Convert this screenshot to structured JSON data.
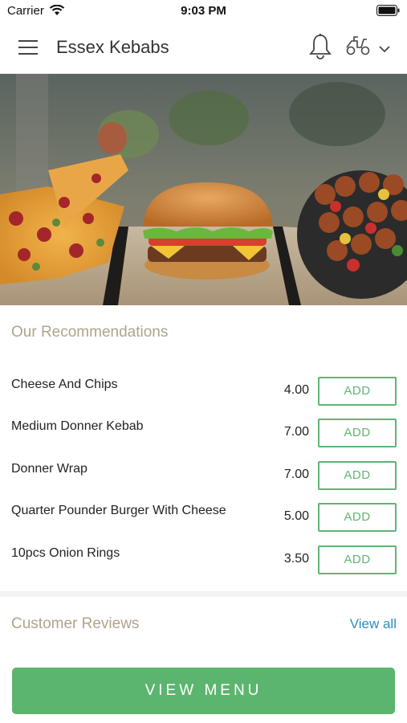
{
  "status_bar": {
    "carrier": "Carrier",
    "time": "9:03 PM"
  },
  "header": {
    "title": "Essex Kebabs",
    "icons": [
      "menu-icon",
      "bell-icon",
      "scooter-icon",
      "chevron-down-icon"
    ]
  },
  "hero": {
    "description": "pizza-burger-kebab-skewers"
  },
  "recommendations": {
    "title": "Our Recommendations",
    "items": [
      {
        "name": "Cheese And Chips",
        "price": "4.00",
        "button": "ADD"
      },
      {
        "name": "Medium Donner Kebab",
        "price": "7.00",
        "button": "ADD"
      },
      {
        "name": "Donner Wrap",
        "price": "7.00",
        "button": "ADD"
      },
      {
        "name": "Quarter Pounder Burger With Cheese",
        "price": "5.00",
        "button": "ADD"
      },
      {
        "name": "10pcs Onion Rings",
        "price": "3.50",
        "button": "ADD"
      }
    ]
  },
  "reviews": {
    "title": "Customer Reviews",
    "view_all": "View all"
  },
  "footer": {
    "button": "VIEW MENU"
  },
  "colors": {
    "accent_green": "#5cb56e",
    "section_title": "#b0a38a",
    "link_blue": "#2f8fc0"
  }
}
